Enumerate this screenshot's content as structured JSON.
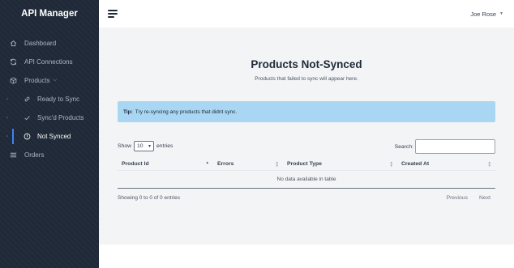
{
  "sidebar": {
    "brand": "API Manager",
    "items": [
      {
        "label": "Dashboard",
        "icon": "home-icon"
      },
      {
        "label": "API Connections",
        "icon": "sync-icon"
      },
      {
        "label": "Products",
        "icon": "box-icon"
      },
      {
        "label": "Ready to Sync",
        "icon": "link-icon"
      },
      {
        "label": "Sync'd Products",
        "icon": "check-icon"
      },
      {
        "label": "Not Synced",
        "icon": "alert-circle-icon",
        "active": true
      },
      {
        "label": "Orders",
        "icon": "list-icon"
      }
    ]
  },
  "topbar": {
    "user_name": "Joe Rose"
  },
  "page": {
    "title": "Products Not-Synced",
    "subtitle": "Products that failed to sync will appear here."
  },
  "tip": {
    "label": "Tip:",
    "text": "Try re-syncing any products that didnt sync."
  },
  "table": {
    "show_label": "Show",
    "entries_value": "10",
    "entries_label": "entries",
    "search_label": "Search:",
    "columns": [
      "Product Id",
      "Errors",
      "Product Type",
      "Created At"
    ],
    "empty_text": "No data available in table",
    "info": "Showing 0 to 0 of 0 entries",
    "prev_label": "Previous",
    "next_label": "Next"
  },
  "colors": {
    "sidebar_bg": "#1f2937",
    "tip_bg": "#a9d6f2",
    "active_accent": "#3b82f6",
    "main_bg": "#f3f4f6"
  }
}
